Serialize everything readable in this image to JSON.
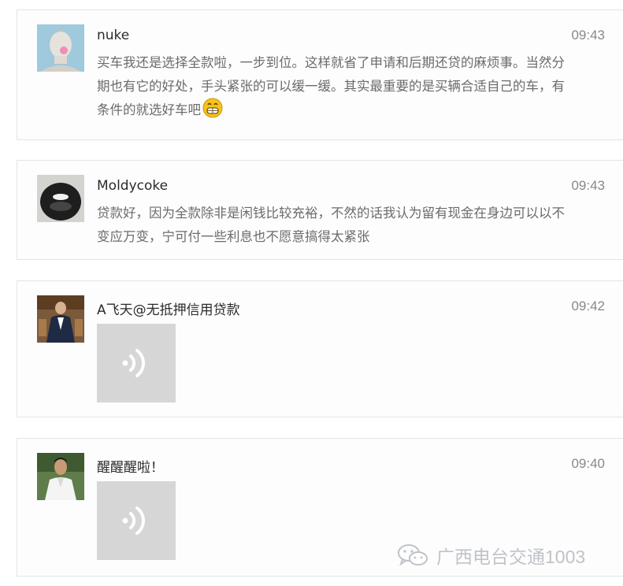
{
  "comments": [
    {
      "name": "nuke",
      "time": "09:43",
      "text": "买车我还是选择全款啦，一步到位。这样就省了申请和后期还贷的麻烦事。当然分期也有它的好处，手头紧张的可以缓一缓。其实最重要的是买辆合适自己的车，有条件的就选好车吧",
      "emoji": "grinning-face-icon"
    },
    {
      "name": "Moldycoke",
      "time": "09:43",
      "text": "贷款好，因为全款除非是闲钱比较充裕，不然的话我认为留有现金在身边可以以不变应万变，宁可付一些利息也不愿意搞得太紧张"
    },
    {
      "name": "A飞天@无抵押信用贷款",
      "time": "09:42",
      "voice": "voice-message-icon"
    },
    {
      "name": "醒醒醒啦！",
      "time": "09:40",
      "voice": "voice-message-icon"
    }
  ],
  "watermark": {
    "text": "广西电台交通1003",
    "icon": "wechat-icon"
  }
}
